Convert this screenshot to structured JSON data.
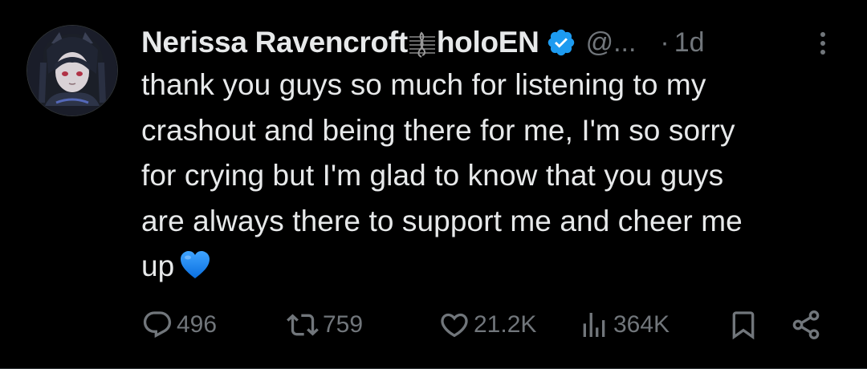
{
  "tweet": {
    "author": {
      "name_part1": "Nerissa Ravencroft",
      "name_emoji": "music-score-emoji",
      "name_part2": "holoEN",
      "verified": true,
      "handle": "@...",
      "avatar": "avatar-image"
    },
    "separator": "·",
    "timestamp": "1d",
    "text_lines": [
      "thank you guys so much for listening to my",
      "crashout and being there for me, I'm so sorry",
      "for crying but I'm glad to know that you guys",
      "are always there to support me and cheer me",
      "up"
    ],
    "text_emoji": "blue-heart-emoji",
    "actions": {
      "replies": "496",
      "retweets": "759",
      "likes": "21.2K",
      "views": "364K"
    }
  },
  "colors": {
    "background": "#000000",
    "primary_text": "#e7e9ea",
    "secondary_text": "#71767b",
    "verified_badge": "#1d9bf0",
    "heart_emoji": "#1e8cff"
  }
}
